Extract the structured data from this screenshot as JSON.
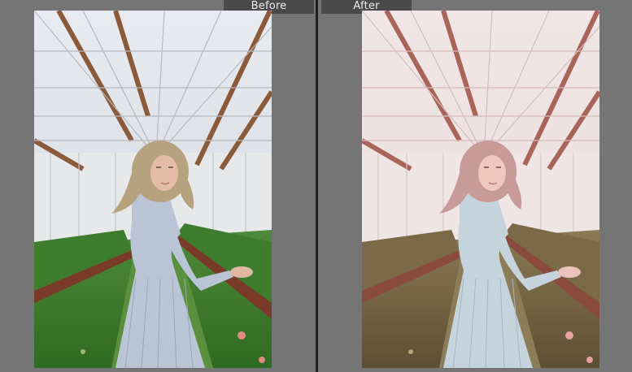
{
  "labels": {
    "before": "Before",
    "after": "After"
  },
  "colors": {
    "workspace": "#757575",
    "divider": "#1f1f1f",
    "tab": "#4a4a4a",
    "tab_text": "#ececec",
    "before_foliage": "#3e7d2e",
    "after_foliage": "#7a6a48",
    "before_hair": "#b7a27f",
    "after_hair": "#c89a98",
    "before_dress": "#b9c4d4",
    "after_dress": "#c5d4dc"
  },
  "icons": {
    "photo": "greenhouse-portrait"
  }
}
